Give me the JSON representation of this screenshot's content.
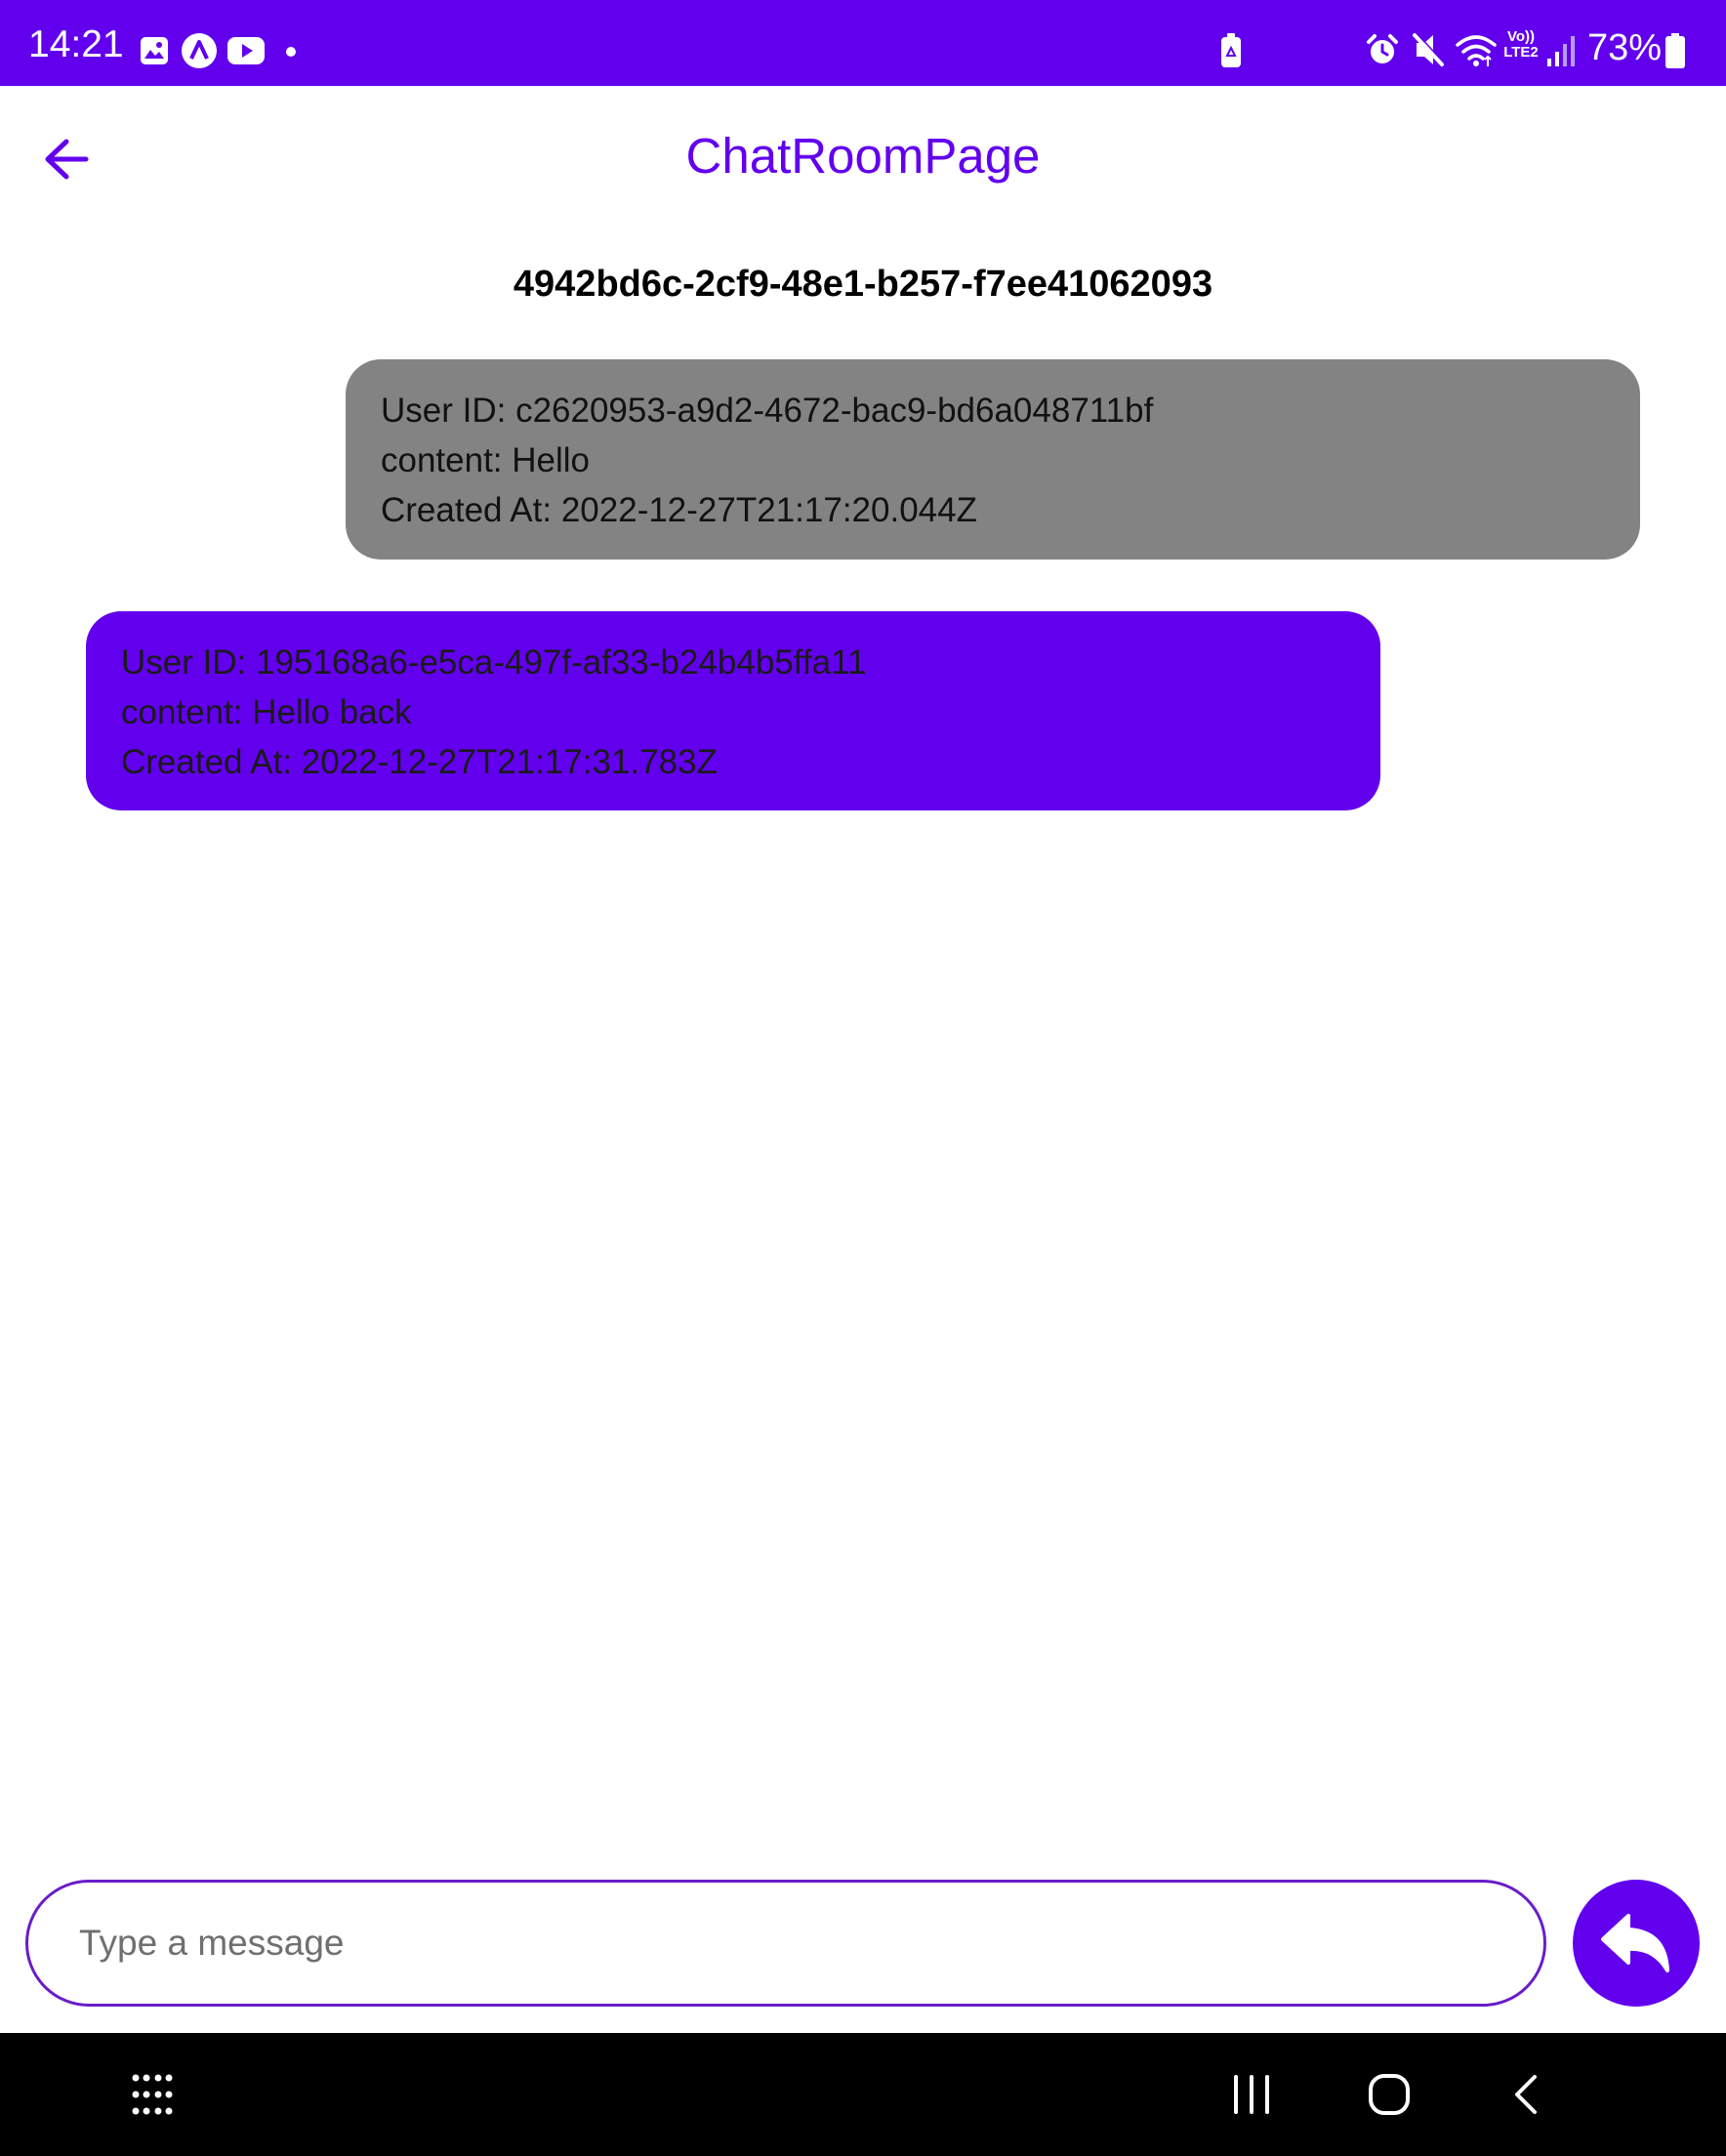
{
  "status_bar": {
    "time": "14:21",
    "battery_percent": "73%",
    "left_icons": [
      "gallery-icon",
      "app-icon",
      "youtube-icon",
      "notification-dot-icon"
    ],
    "right_icons": [
      "battery-saver-icon",
      "alarm-icon",
      "mute-icon",
      "wifi-icon",
      "volte-icon",
      "signal-icon",
      "battery-icon"
    ],
    "network_label_top": "Vo))",
    "network_label_bottom": "LTE2"
  },
  "app_bar": {
    "title": "ChatRoomPage",
    "back_icon": "arrow-back-icon"
  },
  "room": {
    "id": "4942bd6c-2cf9-48e1-b257-f7ee41062093"
  },
  "messages": [
    {
      "user_line": "User ID: c2620953-a9d2-4672-bac9-bd6a048711bf",
      "content_line": "content: Hello",
      "created_line": "Created At: 2022-12-27T21:17:20.044Z",
      "color": "#838383"
    },
    {
      "user_line": "User ID: 195168a6-e5ca-497f-af33-b24b4b5ffa11",
      "content_line": "content: Hello back",
      "created_line": "Created At: 2022-12-27T21:17:31.783Z",
      "color": "#6200ee"
    }
  ],
  "composer": {
    "placeholder": "Type a message",
    "value": "",
    "send_icon": "reply-icon"
  },
  "nav_bar": {
    "icons": [
      "apps-grid-icon",
      "recents-icon",
      "home-icon",
      "back-icon"
    ]
  },
  "colors": {
    "accent": "#6200ee",
    "status_bar": "#6200ee",
    "nav_bar": "#000000",
    "other_bubble": "#838383",
    "own_bubble": "#6200ee"
  }
}
